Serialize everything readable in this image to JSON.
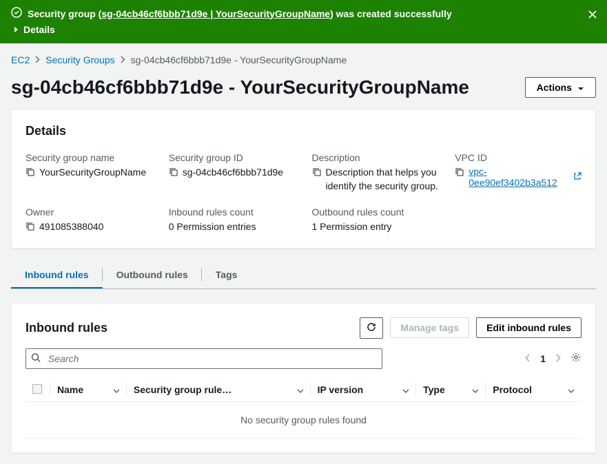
{
  "notification": {
    "prefix": "Security group (",
    "link_text": "sg-04cb46cf6bbb71d9e | YourSecurityGroupName",
    "suffix": ") was created successfully",
    "details_label": "Details"
  },
  "breadcrumb": {
    "items": [
      {
        "label": "EC2"
      },
      {
        "label": "Security Groups"
      }
    ],
    "current": "sg-04cb46cf6bbb71d9e - YourSecurityGroupName"
  },
  "page_title": "sg-04cb46cf6bbb71d9e - YourSecurityGroupName",
  "actions_label": "Actions",
  "details_panel": {
    "title": "Details",
    "fields": {
      "sg_name": {
        "label": "Security group name",
        "value": "YourSecurityGroupName"
      },
      "sg_id": {
        "label": "Security group ID",
        "value": "sg-04cb46cf6bbb71d9e"
      },
      "description": {
        "label": "Description",
        "value": "Description that helps you identify the security group."
      },
      "vpc_id": {
        "label": "VPC ID",
        "value": "vpc-0ee90ef3402b3a512"
      },
      "owner": {
        "label": "Owner",
        "value": "491085388040"
      },
      "inbound_count": {
        "label": "Inbound rules count",
        "value": "0 Permission entries"
      },
      "outbound_count": {
        "label": "Outbound rules count",
        "value": "1 Permission entry"
      }
    }
  },
  "tabs": [
    {
      "label": "Inbound rules",
      "active": true
    },
    {
      "label": "Outbound rules",
      "active": false
    },
    {
      "label": "Tags",
      "active": false
    }
  ],
  "rules_panel": {
    "title": "Inbound rules",
    "manage_tags_label": "Manage tags",
    "edit_label": "Edit inbound rules",
    "search_placeholder": "Search",
    "page_number": "1",
    "columns": [
      "Name",
      "Security group rule…",
      "IP version",
      "Type",
      "Protocol"
    ],
    "empty_message": "No security group rules found"
  }
}
